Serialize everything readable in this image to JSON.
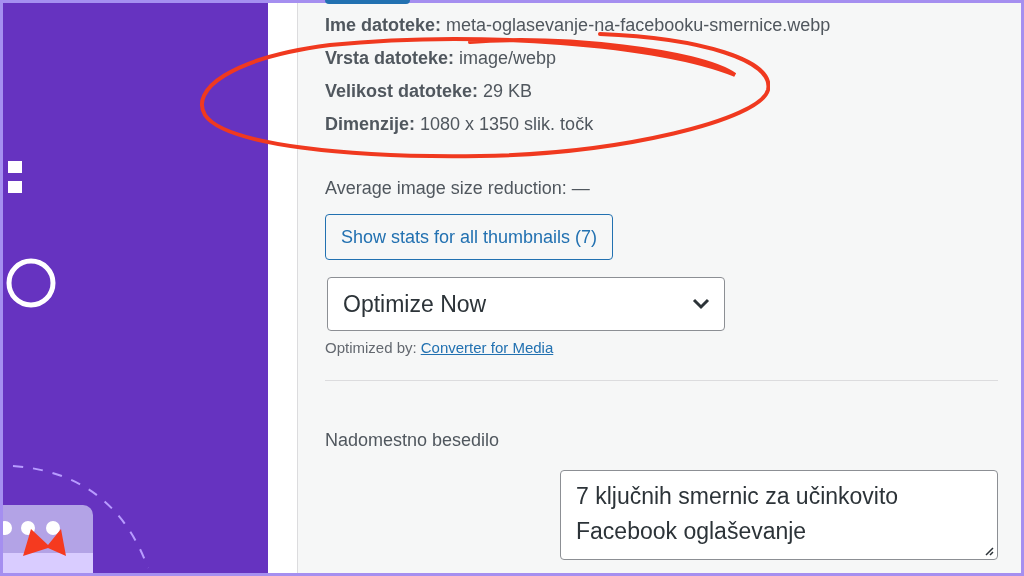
{
  "file_info": [
    {
      "label": "Ime datoteke:",
      "value": "meta-oglasevanje-na-facebooku-smernice.webp"
    },
    {
      "label": "Vrsta datoteke:",
      "value": "image/webp"
    },
    {
      "label": "Velikost datoteke:",
      "value": "29 KB"
    },
    {
      "label": "Dimenzije:",
      "value": "1080 x 1350 slik. točk"
    }
  ],
  "average_reduction": "Average image size reduction: —",
  "stats_button": "Show stats for all thumbnails (7)",
  "optimize_select": {
    "value": "Optimize Now"
  },
  "optimized_by": {
    "label": "Optimized by:",
    "link": "Converter for Media"
  },
  "alt_text": {
    "label": "Nadomestno besedilo",
    "value": "7 ključnih smernic za učinkovito Facebook oglaševanje"
  }
}
